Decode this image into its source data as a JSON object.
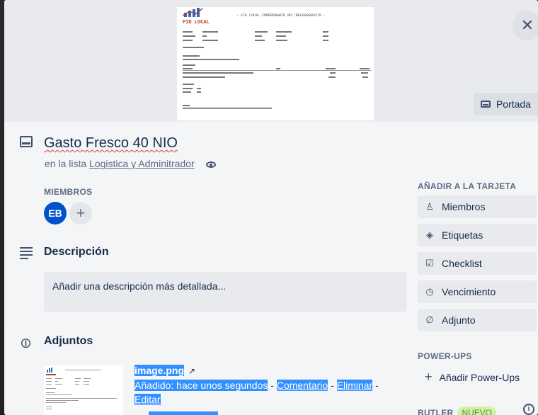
{
  "cover": {
    "doc_header": "- FID LOCAL COMPROBANTE NO.:REC000003270 -",
    "doc_brand": "FID LOCAL",
    "button_label": "Portada"
  },
  "card": {
    "title": "Gasto Fresco 40 NIO",
    "list_prefix": "en la lista",
    "list_name": "Logistica y Adminitrador"
  },
  "members": {
    "label": "MIEMBROS",
    "avatar_initials": "EB"
  },
  "description": {
    "title": "Descripción",
    "placeholder": "Añadir una descripción más detallada..."
  },
  "attachments": {
    "title": "Adjuntos",
    "file_name": "image.png",
    "added": "Añadido: hace unos segundos",
    "dash": "-",
    "comment": "Comentario",
    "delete": "Eliminar",
    "edit": "Editar"
  },
  "sidebar": {
    "add_label": "AÑADIR A LA TARJETA",
    "buttons": [
      {
        "label": "Miembros",
        "icon": "person-icon"
      },
      {
        "label": "Etiquetas",
        "icon": "tag-icon"
      },
      {
        "label": "Checklist",
        "icon": "checkbox-icon"
      },
      {
        "label": "Vencimiento",
        "icon": "clock-icon"
      },
      {
        "label": "Adjunto",
        "icon": "paperclip-icon"
      }
    ],
    "powerups_label": "POWER-UPS",
    "add_powerups": "Añadir Power-Ups",
    "butler_label": "BUTLER",
    "butler_badge": "NUEVO"
  }
}
